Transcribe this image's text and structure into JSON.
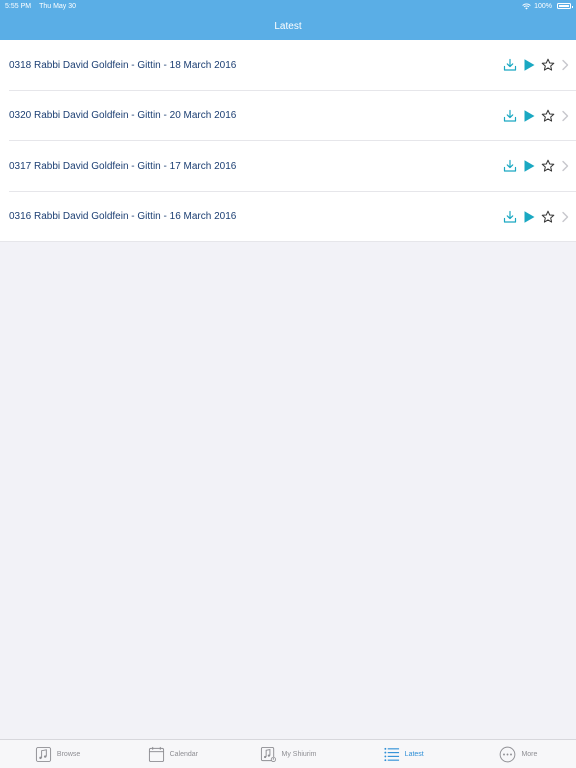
{
  "status_bar": {
    "time": "5:55 PM",
    "date": "Thu May 30",
    "battery": "100%"
  },
  "nav": {
    "title": "Latest"
  },
  "items": [
    {
      "title": "0318 Rabbi David Goldfein - Gittin - 18 March 2016"
    },
    {
      "title": "0320 Rabbi David Goldfein - Gittin - 20 March 2016"
    },
    {
      "title": "0317 Rabbi David Goldfein - Gittin - 17 March 2016"
    },
    {
      "title": "0316 Rabbi David Goldfein - Gittin - 16 March 2016"
    }
  ],
  "tabs": [
    {
      "label": "Browse",
      "icon": "music-note-icon"
    },
    {
      "label": "Calendar",
      "icon": "calendar-icon"
    },
    {
      "label": "My Shiurim",
      "icon": "my-shiurim-icon"
    },
    {
      "label": "Latest",
      "icon": "list-icon"
    },
    {
      "label": "More",
      "icon": "more-icon"
    }
  ],
  "colors": {
    "accent": "#5aaee6",
    "title_text": "#1c3f73",
    "play": "#1aa8c2",
    "active_tab": "#2e8fd6"
  }
}
